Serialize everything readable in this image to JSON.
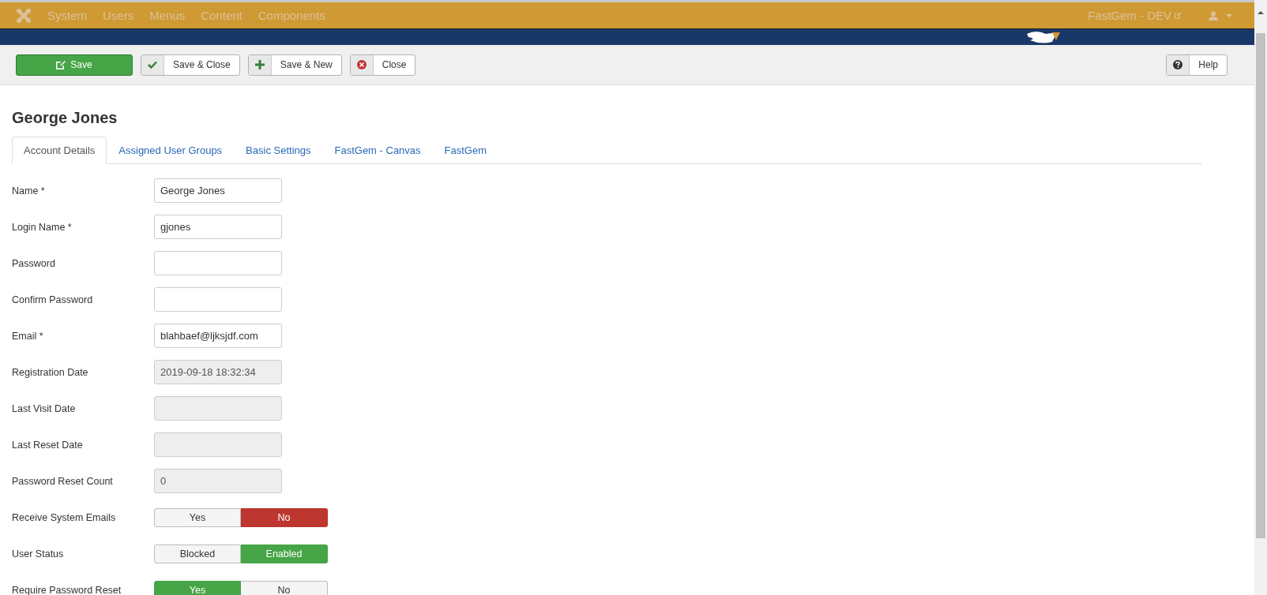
{
  "top_menu": {
    "items": [
      {
        "label": "System"
      },
      {
        "label": "Users"
      },
      {
        "label": "Menus"
      },
      {
        "label": "Content"
      },
      {
        "label": "Components"
      }
    ],
    "site_link": "FastGem - DEV"
  },
  "toolbar": {
    "buttons": [
      {
        "label": "Save",
        "kind": "primary"
      },
      {
        "label": "Save & Close",
        "kind": "default"
      },
      {
        "label": "Save & New",
        "kind": "default"
      },
      {
        "label": "Close",
        "kind": "default"
      }
    ],
    "help": "Help"
  },
  "heading": "George Jones",
  "tabs": [
    {
      "label": "Account Details",
      "selected": true
    },
    {
      "label": "Assigned User Groups",
      "selected": false
    },
    {
      "label": "Basic Settings",
      "selected": false
    },
    {
      "label": "FastGem - Canvas",
      "selected": false
    },
    {
      "label": "FastGem",
      "selected": false
    }
  ],
  "fields": [
    {
      "label": "Name *",
      "kind": "text",
      "value": "George Jones"
    },
    {
      "label": "Login Name *",
      "kind": "text",
      "value": "gjones"
    },
    {
      "label": "Password",
      "kind": "text"
    },
    {
      "label": "Confirm Password",
      "kind": "text"
    },
    {
      "label": "Email *",
      "kind": "text",
      "value": "blahbaef@ljksjdf.com"
    },
    {
      "label": "Registration Date",
      "kind": "readonly",
      "value": "2019-09-18 18:32:34"
    },
    {
      "label": "Last Visit Date",
      "kind": "readonly"
    },
    {
      "label": "Last Reset Date",
      "kind": "readonly"
    },
    {
      "label": "Password Reset Count",
      "kind": "readonly",
      "value": "0"
    },
    {
      "label": "Receive System Emails",
      "kind": "toggle",
      "options": [
        {
          "label": "Yes",
          "selected": false
        },
        {
          "label": "No",
          "selected": true,
          "color": "#bd362f"
        }
      ]
    },
    {
      "label": "User Status",
      "kind": "toggle",
      "options": [
        {
          "label": "Blocked",
          "selected": false
        },
        {
          "label": "Enabled",
          "selected": true,
          "color": "#46a546"
        }
      ]
    },
    {
      "label": "Require Password Reset",
      "kind": "toggle",
      "options": [
        {
          "label": "Yes",
          "selected": true,
          "color": "#46a546"
        },
        {
          "label": "No",
          "selected": false
        }
      ]
    }
  ]
}
